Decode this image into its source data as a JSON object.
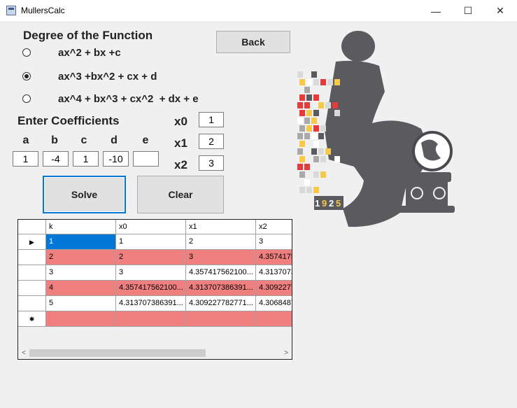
{
  "window": {
    "title": "MullersCalc",
    "minimize_glyph": "—",
    "maximize_glyph": "☐",
    "close_glyph": "✕"
  },
  "degree": {
    "heading": "Degree of the Function",
    "options": [
      {
        "label": "ax^2 + bx +c",
        "checked": false
      },
      {
        "label": "ax^3 +bx^2 + cx + d",
        "checked": true
      },
      {
        "label": "ax^4 + bx^3 + cx^2  + dx + e",
        "checked": false
      }
    ]
  },
  "buttons": {
    "back": "Back",
    "solve": "Solve",
    "clear": "Clear"
  },
  "coefficients": {
    "heading": "Enter Coefficients",
    "labels": [
      "a",
      "b",
      "c",
      "d",
      "e"
    ],
    "values": [
      "1",
      "-4",
      "1",
      "-10",
      ""
    ]
  },
  "initial": {
    "x0_label": "x0",
    "x0": "1",
    "x1_label": "x1",
    "x1": "2",
    "x2_label": "x2",
    "x2": "3"
  },
  "table": {
    "columns": [
      "k",
      "x0",
      "x1",
      "x2"
    ],
    "rows": [
      [
        "1",
        "1",
        "2",
        "3"
      ],
      [
        "2",
        "2",
        "3",
        "4.3574175"
      ],
      [
        "3",
        "3",
        "4.357417562100...",
        "4.3137073"
      ],
      [
        "4",
        "4.357417562100...",
        "4.313707386391...",
        "4.3092277"
      ],
      [
        "5",
        "4.313707386391...",
        "4.309227782771...",
        "4.3068487"
      ],
      [
        "",
        "",
        "",
        ""
      ]
    ],
    "row_markers": [
      "▶",
      "",
      "",
      "",
      "",
      "✱"
    ],
    "row_colors": [
      "#ffffff",
      "#f08080",
      "#ffffff",
      "#f08080",
      "#ffffff",
      "#f08080"
    ],
    "selected_color": "#0078d7"
  },
  "colors": {
    "accent": "#0078d7",
    "highlight_row": "#f08080",
    "logo_gray": "#5b5b5f"
  },
  "logo": {
    "year": [
      "1",
      "9",
      "2",
      "5"
    ]
  }
}
